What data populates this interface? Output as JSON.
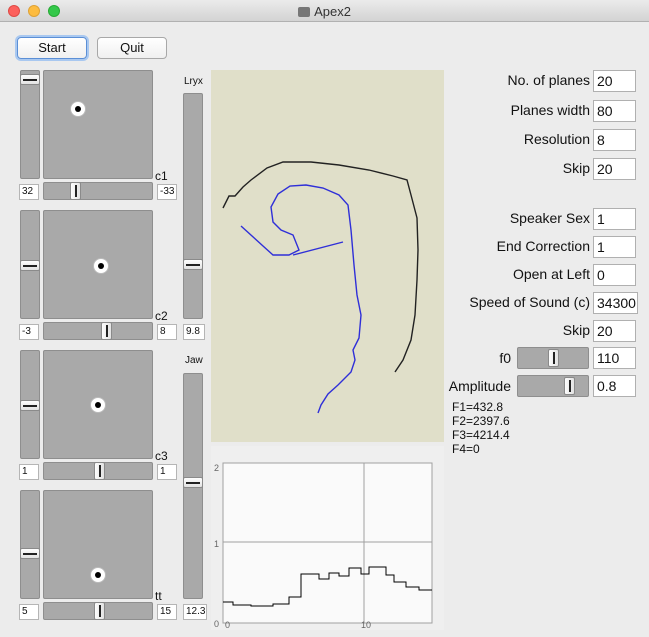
{
  "window": {
    "title": "Apex2"
  },
  "toolbar": {
    "start_label": "Start",
    "quit_label": "Quit"
  },
  "articulators": [
    {
      "name": "c1",
      "value_left": "32",
      "value_right": "-33"
    },
    {
      "name": "c2",
      "value_left": "-3",
      "value_right": "8"
    },
    {
      "name": "c3",
      "value_left": "1",
      "value_right": "1"
    },
    {
      "name": "tt",
      "value_left": "5",
      "value_right": "15"
    }
  ],
  "lryx": {
    "label": "Lryx",
    "value": "9.8"
  },
  "jaw": {
    "label": "Jaw",
    "value": "12.3"
  },
  "params": {
    "planes_label": "No. of planes",
    "planes_value": "20",
    "width_label": "Planes width",
    "width_value": "80",
    "resolution_label": "Resolution",
    "resolution_value": "8",
    "skip1_label": "Skip",
    "skip1_value": "20",
    "sex_label": "Speaker Sex",
    "sex_value": "1",
    "endcorr_label": "End Correction",
    "endcorr_value": "1",
    "openleft_label": "Open at Left",
    "openleft_value": "0",
    "sos_label": "Speed of Sound (c)",
    "sos_value": "34300",
    "skip2_label": "Skip",
    "skip2_value": "20",
    "f0_label": "f0",
    "f0_value": "110",
    "amp_label": "Amplitude",
    "amp_value": "0.8"
  },
  "formants": {
    "f1": "F1=432.8",
    "f2": "F2=2397.6",
    "f3": "F3=4214.4",
    "f4": "F4=0"
  },
  "spectrum_axis": {
    "y2": "2",
    "y1": "1",
    "y0": "0",
    "x0": "0",
    "x10": "10"
  },
  "colors": {
    "tract_outline": "#222222",
    "tongue": "#2f2fd8",
    "spectrum": "#000000"
  }
}
